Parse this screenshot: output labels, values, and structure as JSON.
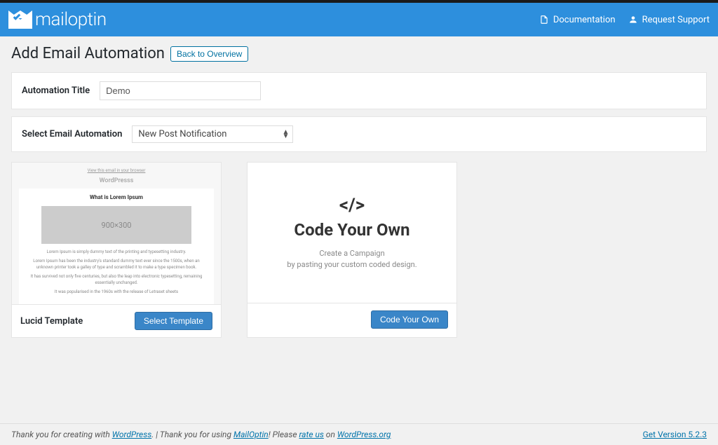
{
  "header": {
    "brand": "mailoptin",
    "links": {
      "documentation": "Documentation",
      "support": "Request Support"
    }
  },
  "page": {
    "title": "Add Email Automation",
    "back_btn": "Back to Overview"
  },
  "panel_title": {
    "label": "Automation Title",
    "value": "Demo"
  },
  "panel_select": {
    "label": "Select Email Automation",
    "value": "New Post Notification"
  },
  "templates": {
    "lucid": {
      "name": "Lucid Template",
      "button": "Select Template",
      "preview": {
        "viewlink": "View this email in your browser",
        "brand": "WordPresss",
        "heading": "What is Lorem Ipsum",
        "placeholder": "900×300",
        "p1": "Lorem Ipsum is simply dummy text of the printing and typesetting industry.",
        "p2": "Lorem Ipsum has been the industry's standard dummy text ever since the 1500s, when an unknown printer took a galley of type and scrambled it to make a type specimen book.",
        "p3": "It has survived not only five centuries, but also the leap into electronic typesetting, remaining essentially unchanged.",
        "p4": "It was popularised in the 1960s with the release of Letraset sheets"
      }
    },
    "code": {
      "icon": "</>",
      "title": "Code Your Own",
      "sub1": "Create a Campaign",
      "sub2": "by pasting your custom coded design.",
      "button": "Code Your Own"
    }
  },
  "footer": {
    "t1": "Thank you for creating with ",
    "wp": "WordPress",
    "t2": ". | Thank you for using ",
    "mo": "MailOptin",
    "t3": "! Please ",
    "rate": "rate us",
    "t4": " on ",
    "wporg": "WordPress.org",
    "version": "Get Version 5.2.3"
  }
}
